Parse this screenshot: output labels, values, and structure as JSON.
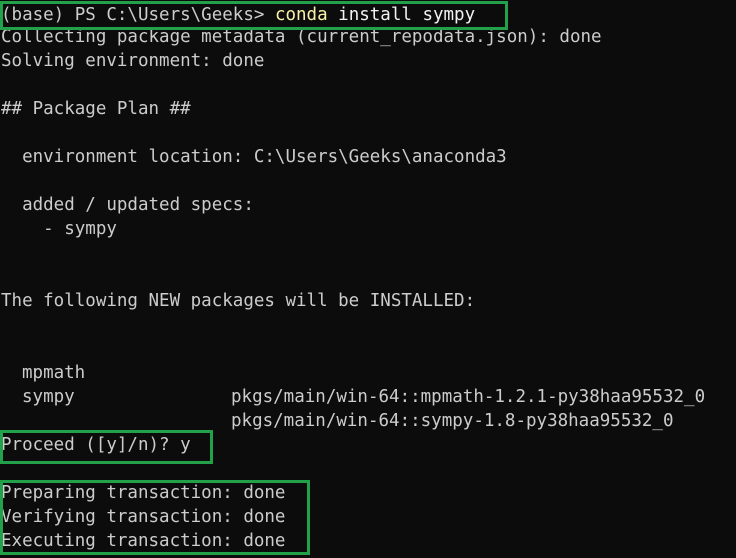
{
  "terminal": {
    "prompt": "(base) PS C:\\Users\\Geeks> ",
    "command_word": "conda",
    "command_args": " install sympy",
    "collecting": "Collecting package metadata (current_repodata.json): done",
    "solving": "Solving environment: done",
    "plan_header": "## Package Plan ##",
    "env_location": "  environment location: C:\\Users\\Geeks\\anaconda3",
    "specs_header": "  added / updated specs:",
    "spec_item": "    - sympy",
    "new_packages_header": "The following NEW packages will be INSTALLED:",
    "packages": [
      {
        "name": "mpmath",
        "path": "pkgs/main/win-64::mpmath-1.2.1-py38haa95532_0"
      },
      {
        "name": "sympy",
        "path": "pkgs/main/win-64::sympy-1.8-py38haa95532_0"
      }
    ],
    "proceed_prompt": "Proceed ([y]/n)? y",
    "preparing": "Preparing transaction: done",
    "verifying": "Verifying transaction: done",
    "executing": "Executing transaction: done"
  },
  "colors": {
    "background": "#0c0c0c",
    "text": "#cccccc",
    "command_highlight": "#f9f1a5",
    "highlight_border": "#23a04a"
  }
}
